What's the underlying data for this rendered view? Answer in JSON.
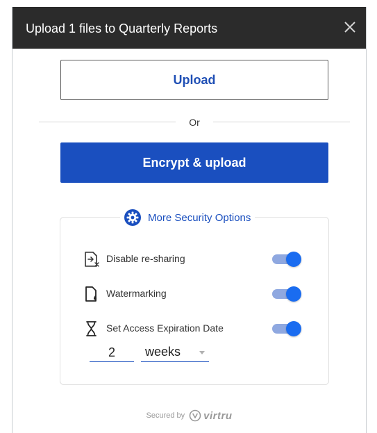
{
  "header": {
    "title": "Upload 1 files to Quarterly Reports",
    "close_icon": "close-icon"
  },
  "actions": {
    "upload_label": "Upload",
    "divider_text": "Or",
    "encrypt_upload_label": "Encrypt & upload"
  },
  "security": {
    "title": "More Security Options",
    "title_icon": "gear-icon",
    "options": [
      {
        "label": "Disable re-sharing",
        "icon": "disable-resharing-icon",
        "enabled": true
      },
      {
        "label": "Watermarking",
        "icon": "watermark-icon",
        "enabled": true
      },
      {
        "label": "Set Access Expiration Date",
        "icon": "hourglass-icon",
        "enabled": true
      }
    ],
    "expiration": {
      "amount": "2",
      "unit": "weeks"
    }
  },
  "footer": {
    "secured_by": "Secured by",
    "brand": "virtru"
  },
  "colors": {
    "header_bg": "#2b2b2b",
    "primary_blue": "#1a4fbf",
    "toggle_track": "#8fa8e0",
    "toggle_thumb": "#1a6cf0"
  }
}
